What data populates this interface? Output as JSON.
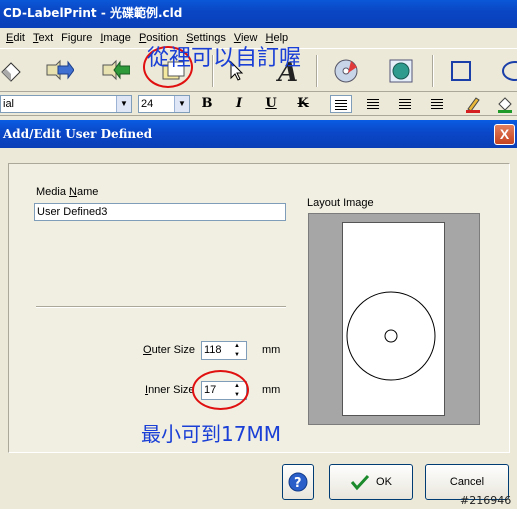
{
  "app": {
    "title": "CD-LabelPrint - 光碟範例.cld",
    "menu": [
      {
        "key": "E",
        "rest": "dit"
      },
      {
        "key": "T",
        "rest": "ext"
      },
      {
        "key": "",
        "text": "Figure"
      },
      {
        "key": "I",
        "rest": "mage"
      },
      {
        "key": "P",
        "rest": "osition"
      },
      {
        "key": "S",
        "rest": "ettings"
      },
      {
        "key": "V",
        "rest": "iew"
      },
      {
        "key": "H",
        "rest": "elp"
      }
    ],
    "font_name": "ial",
    "font_size": "24",
    "format_buttons": {
      "bold": "B",
      "italic": "I",
      "underline": "U",
      "strike": "K"
    }
  },
  "annotations": {
    "top_note": "從裡可以自訂喔",
    "bottom_note": "最小可到17MM",
    "watermark": "#216946",
    "color": "#e01010"
  },
  "dialog": {
    "title": "Add/Edit User Defined",
    "close_label": "X",
    "media_name_label_pre": "Media ",
    "media_name_label_key": "N",
    "media_name_label_post": "ame",
    "media_name_value": "User Defined3",
    "layout_image_label": "Layout Image",
    "outer_label_key": "O",
    "outer_label_rest": "uter Size",
    "outer_value": "118",
    "outer_unit": "mm",
    "inner_label_key": "I",
    "inner_label_rest": "nner Size",
    "inner_value": "17",
    "inner_unit": "mm",
    "help_icon": "?",
    "ok_label": "OK",
    "cancel_label": "Cancel"
  }
}
